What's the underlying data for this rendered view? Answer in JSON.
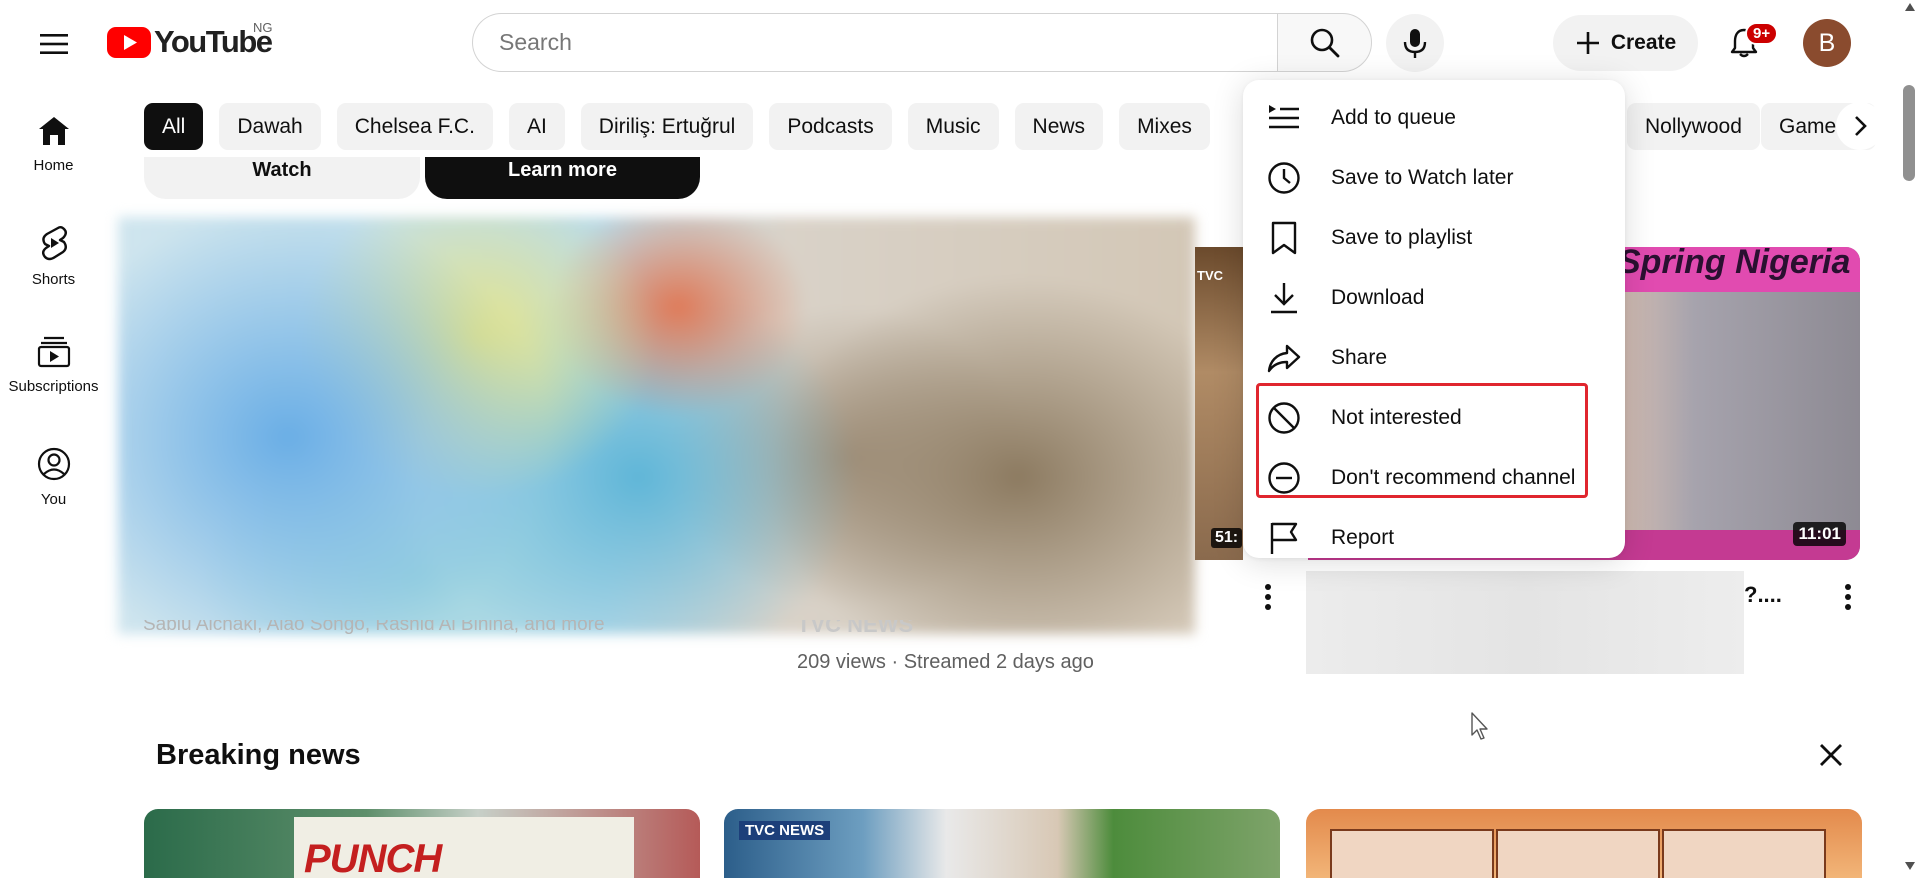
{
  "header": {
    "logo_text": "YouTube",
    "country_code": "NG",
    "search_placeholder": "Search",
    "create_label": "Create",
    "notifications_badge": "9+",
    "avatar_initial": "B"
  },
  "sidebar": {
    "items": [
      {
        "label": "Home",
        "icon": "home-icon"
      },
      {
        "label": "Shorts",
        "icon": "shorts-icon"
      },
      {
        "label": "Subscriptions",
        "icon": "subscriptions-icon"
      },
      {
        "label": "You",
        "icon": "you-icon"
      }
    ]
  },
  "chips": {
    "items": [
      "All",
      "Dawah",
      "Chelsea F.C.",
      "AI",
      "Diriliş: Ertuğrul",
      "Podcasts",
      "Music",
      "News",
      "Mixes"
    ],
    "right_items": [
      "Nollywood",
      "Game"
    ],
    "active": "All"
  },
  "ad": {
    "watch_label": "Watch",
    "learn_more_label": "Learn more",
    "partial_caption": "Sabiu Alchaki, Alao Songo, Rashid Al Binina, and more"
  },
  "videos": {
    "middle": {
      "partial_title": "TVC NEWS",
      "meta": "209 views · Streamed 2 days ago",
      "thumb_tag": "TVC",
      "duration": "51:"
    },
    "right": {
      "thumb_banner": "Spring Nigeria",
      "duration": "11:01",
      "title_tail": "?...."
    }
  },
  "context_menu": {
    "items": [
      {
        "label": "Add to queue",
        "icon": "add-to-queue-icon"
      },
      {
        "label": "Save to Watch later",
        "icon": "clock-icon"
      },
      {
        "label": "Save to playlist",
        "icon": "bookmark-icon"
      },
      {
        "label": "Download",
        "icon": "download-icon"
      },
      {
        "label": "Share",
        "icon": "share-icon"
      },
      {
        "label": "Not interested",
        "icon": "block-icon"
      },
      {
        "label": "Don't recommend channel",
        "icon": "minus-circle-icon"
      },
      {
        "label": "Report",
        "icon": "flag-icon"
      }
    ],
    "highlighted": [
      "Not interested",
      "Don't recommend channel"
    ],
    "highlight_color": "#e0262e"
  },
  "breaking_news": {
    "title": "Breaking news",
    "thumbs": [
      {
        "text": "PUNCH"
      },
      {
        "text": "TVC NEWS"
      },
      {
        "text": ""
      }
    ]
  },
  "colors": {
    "brand_red": "#ff0000",
    "badge_red": "#cc0000",
    "text_primary": "#0f0f0f",
    "text_secondary": "#606060"
  }
}
